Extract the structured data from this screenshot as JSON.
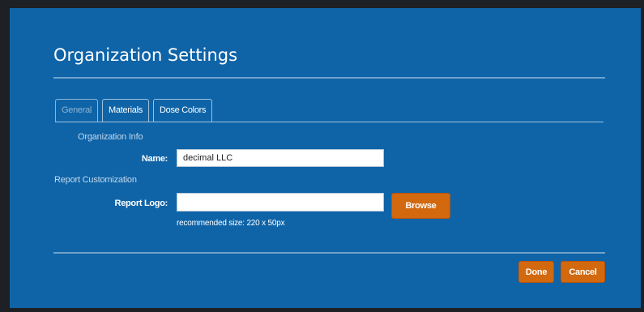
{
  "dialog": {
    "title": "Organization Settings",
    "tabs": [
      {
        "label": "General",
        "active": true
      },
      {
        "label": "Materials",
        "active": false
      },
      {
        "label": "Dose Colors",
        "active": false
      }
    ],
    "org_info": {
      "section_label": "Organization Info",
      "name_label": "Name:",
      "name_value": "decimal LLC"
    },
    "report": {
      "section_label": "Report Customization",
      "logo_label": "Report Logo:",
      "logo_value": "",
      "browse_label": "Browse",
      "hint": "recommended size: 220 x 50px"
    },
    "footer": {
      "done_label": "Done",
      "cancel_label": "Cancel"
    }
  },
  "colors": {
    "dialog_bg": "#0f64a8",
    "accent_button": "#d2690f",
    "backdrop": "#1d2024"
  }
}
